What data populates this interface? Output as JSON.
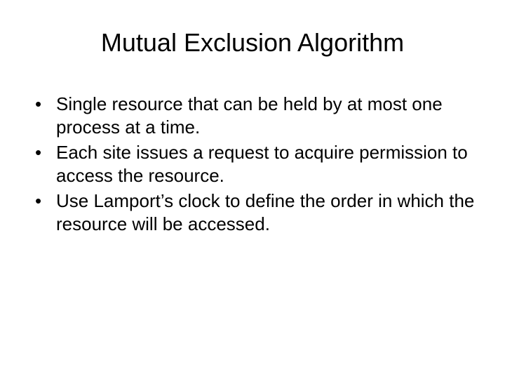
{
  "slide": {
    "title": "Mutual Exclusion Algorithm",
    "bullets": [
      "Single resource that can be held by at most one process at a time.",
      "Each site issues a request to acquire permission to access the resource.",
      "Use Lamport’s clock to define the order in which the resource will be accessed."
    ]
  }
}
